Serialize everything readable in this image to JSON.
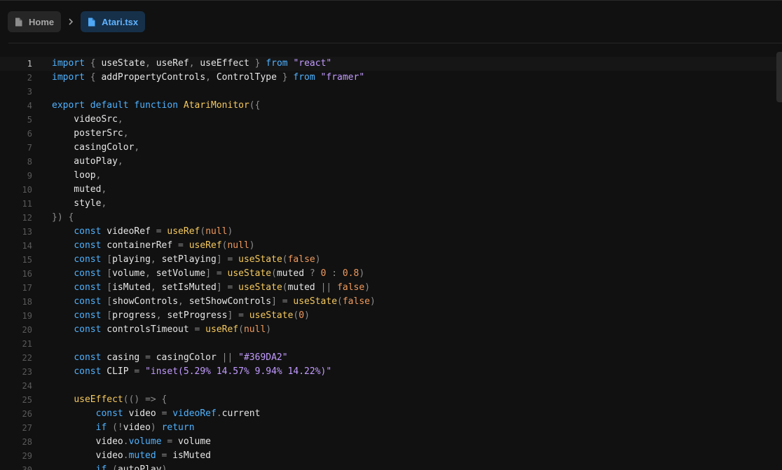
{
  "breadcrumb": {
    "home_label": "Home",
    "file_label": "Atari.tsx",
    "separator_icon": "chevron-right-icon"
  },
  "icons": {
    "file": "file-icon",
    "chevron": "chevron-right-icon"
  },
  "colors": {
    "background": "#111111",
    "keyword": "#4fb2ff",
    "function": "#f5c95f",
    "string": "#c29bff",
    "number": "#f09a5c",
    "active_tab_bg": "#16304a",
    "active_tab_text": "#5fb3ff"
  },
  "editor": {
    "current_line": 1,
    "lines": [
      {
        "n": "1",
        "tokens": [
          {
            "t": "import",
            "c": "kw"
          },
          {
            "t": " { ",
            "c": "pun"
          },
          {
            "t": "useState"
          },
          {
            "t": ", ",
            "c": "pun"
          },
          {
            "t": "useRef"
          },
          {
            "t": ", ",
            "c": "pun"
          },
          {
            "t": "useEffect"
          },
          {
            "t": " } ",
            "c": "pun"
          },
          {
            "t": "from",
            "c": "kw"
          },
          {
            "t": " "
          },
          {
            "t": "\"react\"",
            "c": "str"
          }
        ]
      },
      {
        "n": "2",
        "tokens": [
          {
            "t": "import",
            "c": "kw"
          },
          {
            "t": " { ",
            "c": "pun"
          },
          {
            "t": "addPropertyControls"
          },
          {
            "t": ", ",
            "c": "pun"
          },
          {
            "t": "ControlType"
          },
          {
            "t": " } ",
            "c": "pun"
          },
          {
            "t": "from",
            "c": "kw"
          },
          {
            "t": " "
          },
          {
            "t": "\"framer\"",
            "c": "str"
          }
        ]
      },
      {
        "n": "3",
        "tokens": []
      },
      {
        "n": "4",
        "tokens": [
          {
            "t": "export",
            "c": "kw"
          },
          {
            "t": " "
          },
          {
            "t": "default",
            "c": "kw"
          },
          {
            "t": " "
          },
          {
            "t": "function",
            "c": "kw"
          },
          {
            "t": " "
          },
          {
            "t": "AtariMonitor",
            "c": "fn"
          },
          {
            "t": "({",
            "c": "pun"
          }
        ]
      },
      {
        "n": "5",
        "tokens": [
          {
            "t": "    videoSrc"
          },
          {
            "t": ",",
            "c": "pun"
          }
        ]
      },
      {
        "n": "6",
        "tokens": [
          {
            "t": "    posterSrc"
          },
          {
            "t": ",",
            "c": "pun"
          }
        ]
      },
      {
        "n": "7",
        "tokens": [
          {
            "t": "    casingColor"
          },
          {
            "t": ",",
            "c": "pun"
          }
        ]
      },
      {
        "n": "8",
        "tokens": [
          {
            "t": "    autoPlay"
          },
          {
            "t": ",",
            "c": "pun"
          }
        ]
      },
      {
        "n": "9",
        "tokens": [
          {
            "t": "    loop"
          },
          {
            "t": ",",
            "c": "pun"
          }
        ]
      },
      {
        "n": "10",
        "tokens": [
          {
            "t": "    muted"
          },
          {
            "t": ",",
            "c": "pun"
          }
        ]
      },
      {
        "n": "11",
        "tokens": [
          {
            "t": "    style"
          },
          {
            "t": ",",
            "c": "pun"
          }
        ]
      },
      {
        "n": "12",
        "tokens": [
          {
            "t": "}) {",
            "c": "pun"
          }
        ]
      },
      {
        "n": "13",
        "tokens": [
          {
            "t": "    "
          },
          {
            "t": "const",
            "c": "kw"
          },
          {
            "t": " videoRef "
          },
          {
            "t": "=",
            "c": "pun"
          },
          {
            "t": " "
          },
          {
            "t": "useRef",
            "c": "fn"
          },
          {
            "t": "(",
            "c": "pun"
          },
          {
            "t": "null",
            "c": "num"
          },
          {
            "t": ")",
            "c": "pun"
          }
        ]
      },
      {
        "n": "14",
        "tokens": [
          {
            "t": "    "
          },
          {
            "t": "const",
            "c": "kw"
          },
          {
            "t": " containerRef "
          },
          {
            "t": "=",
            "c": "pun"
          },
          {
            "t": " "
          },
          {
            "t": "useRef",
            "c": "fn"
          },
          {
            "t": "(",
            "c": "pun"
          },
          {
            "t": "null",
            "c": "num"
          },
          {
            "t": ")",
            "c": "pun"
          }
        ]
      },
      {
        "n": "15",
        "tokens": [
          {
            "t": "    "
          },
          {
            "t": "const",
            "c": "kw"
          },
          {
            "t": " [",
            "c": "pun"
          },
          {
            "t": "playing"
          },
          {
            "t": ", ",
            "c": "pun"
          },
          {
            "t": "setPlaying"
          },
          {
            "t": "] = ",
            "c": "pun"
          },
          {
            "t": "useState",
            "c": "fn"
          },
          {
            "t": "(",
            "c": "pun"
          },
          {
            "t": "false",
            "c": "num"
          },
          {
            "t": ")",
            "c": "pun"
          }
        ]
      },
      {
        "n": "16",
        "tokens": [
          {
            "t": "    "
          },
          {
            "t": "const",
            "c": "kw"
          },
          {
            "t": " [",
            "c": "pun"
          },
          {
            "t": "volume"
          },
          {
            "t": ", ",
            "c": "pun"
          },
          {
            "t": "setVolume"
          },
          {
            "t": "] = ",
            "c": "pun"
          },
          {
            "t": "useState",
            "c": "fn"
          },
          {
            "t": "(",
            "c": "pun"
          },
          {
            "t": "muted "
          },
          {
            "t": "? ",
            "c": "pun"
          },
          {
            "t": "0",
            "c": "num"
          },
          {
            "t": " : ",
            "c": "pun"
          },
          {
            "t": "0.8",
            "c": "num"
          },
          {
            "t": ")",
            "c": "pun"
          }
        ]
      },
      {
        "n": "17",
        "tokens": [
          {
            "t": "    "
          },
          {
            "t": "const",
            "c": "kw"
          },
          {
            "t": " [",
            "c": "pun"
          },
          {
            "t": "isMuted"
          },
          {
            "t": ", ",
            "c": "pun"
          },
          {
            "t": "setIsMuted"
          },
          {
            "t": "] = ",
            "c": "pun"
          },
          {
            "t": "useState",
            "c": "fn"
          },
          {
            "t": "(",
            "c": "pun"
          },
          {
            "t": "muted "
          },
          {
            "t": "|| ",
            "c": "pun"
          },
          {
            "t": "false",
            "c": "num"
          },
          {
            "t": ")",
            "c": "pun"
          }
        ]
      },
      {
        "n": "18",
        "tokens": [
          {
            "t": "    "
          },
          {
            "t": "const",
            "c": "kw"
          },
          {
            "t": " [",
            "c": "pun"
          },
          {
            "t": "showControls"
          },
          {
            "t": ", ",
            "c": "pun"
          },
          {
            "t": "setShowControls"
          },
          {
            "t": "] = ",
            "c": "pun"
          },
          {
            "t": "useState",
            "c": "fn"
          },
          {
            "t": "(",
            "c": "pun"
          },
          {
            "t": "false",
            "c": "num"
          },
          {
            "t": ")",
            "c": "pun"
          }
        ]
      },
      {
        "n": "19",
        "tokens": [
          {
            "t": "    "
          },
          {
            "t": "const",
            "c": "kw"
          },
          {
            "t": " [",
            "c": "pun"
          },
          {
            "t": "progress"
          },
          {
            "t": ", ",
            "c": "pun"
          },
          {
            "t": "setProgress"
          },
          {
            "t": "] = ",
            "c": "pun"
          },
          {
            "t": "useState",
            "c": "fn"
          },
          {
            "t": "(",
            "c": "pun"
          },
          {
            "t": "0",
            "c": "num"
          },
          {
            "t": ")",
            "c": "pun"
          }
        ]
      },
      {
        "n": "20",
        "tokens": [
          {
            "t": "    "
          },
          {
            "t": "const",
            "c": "kw"
          },
          {
            "t": " controlsTimeout "
          },
          {
            "t": "=",
            "c": "pun"
          },
          {
            "t": " "
          },
          {
            "t": "useRef",
            "c": "fn"
          },
          {
            "t": "(",
            "c": "pun"
          },
          {
            "t": "null",
            "c": "num"
          },
          {
            "t": ")",
            "c": "pun"
          }
        ]
      },
      {
        "n": "21",
        "tokens": []
      },
      {
        "n": "22",
        "tokens": [
          {
            "t": "    "
          },
          {
            "t": "const",
            "c": "kw"
          },
          {
            "t": " casing "
          },
          {
            "t": "=",
            "c": "pun"
          },
          {
            "t": " casingColor "
          },
          {
            "t": "||",
            "c": "pun"
          },
          {
            "t": " "
          },
          {
            "t": "\"#369DA2\"",
            "c": "str"
          }
        ]
      },
      {
        "n": "23",
        "tokens": [
          {
            "t": "    "
          },
          {
            "t": "const",
            "c": "kw"
          },
          {
            "t": " CLIP "
          },
          {
            "t": "=",
            "c": "pun"
          },
          {
            "t": " "
          },
          {
            "t": "\"inset(5.29% 14.57% 9.94% 14.22%)\"",
            "c": "str"
          }
        ]
      },
      {
        "n": "24",
        "tokens": []
      },
      {
        "n": "25",
        "tokens": [
          {
            "t": "    "
          },
          {
            "t": "useEffect",
            "c": "fn"
          },
          {
            "t": "(() => {",
            "c": "pun"
          }
        ]
      },
      {
        "n": "26",
        "tokens": [
          {
            "t": "        "
          },
          {
            "t": "const",
            "c": "kw"
          },
          {
            "t": " video "
          },
          {
            "t": "=",
            "c": "pun"
          },
          {
            "t": " "
          },
          {
            "t": "videoRef",
            "c": "prop"
          },
          {
            "t": ".",
            "c": "pun"
          },
          {
            "t": "current"
          }
        ]
      },
      {
        "n": "27",
        "tokens": [
          {
            "t": "        "
          },
          {
            "t": "if",
            "c": "kw"
          },
          {
            "t": " (!",
            "c": "pun"
          },
          {
            "t": "video"
          },
          {
            "t": ") ",
            "c": "pun"
          },
          {
            "t": "return",
            "c": "kw"
          }
        ]
      },
      {
        "n": "28",
        "tokens": [
          {
            "t": "        video"
          },
          {
            "t": ".",
            "c": "pun"
          },
          {
            "t": "volume",
            "c": "prop"
          },
          {
            "t": " "
          },
          {
            "t": "=",
            "c": "pun"
          },
          {
            "t": " volume"
          }
        ]
      },
      {
        "n": "29",
        "tokens": [
          {
            "t": "        video"
          },
          {
            "t": ".",
            "c": "pun"
          },
          {
            "t": "muted",
            "c": "prop"
          },
          {
            "t": " "
          },
          {
            "t": "=",
            "c": "pun"
          },
          {
            "t": " isMuted"
          }
        ]
      },
      {
        "n": "30",
        "tokens": [
          {
            "t": "        "
          },
          {
            "t": "if",
            "c": "kw"
          },
          {
            "t": " (",
            "c": "pun"
          },
          {
            "t": "autoPlay"
          },
          {
            "t": ")",
            "c": "pun"
          }
        ]
      }
    ]
  }
}
